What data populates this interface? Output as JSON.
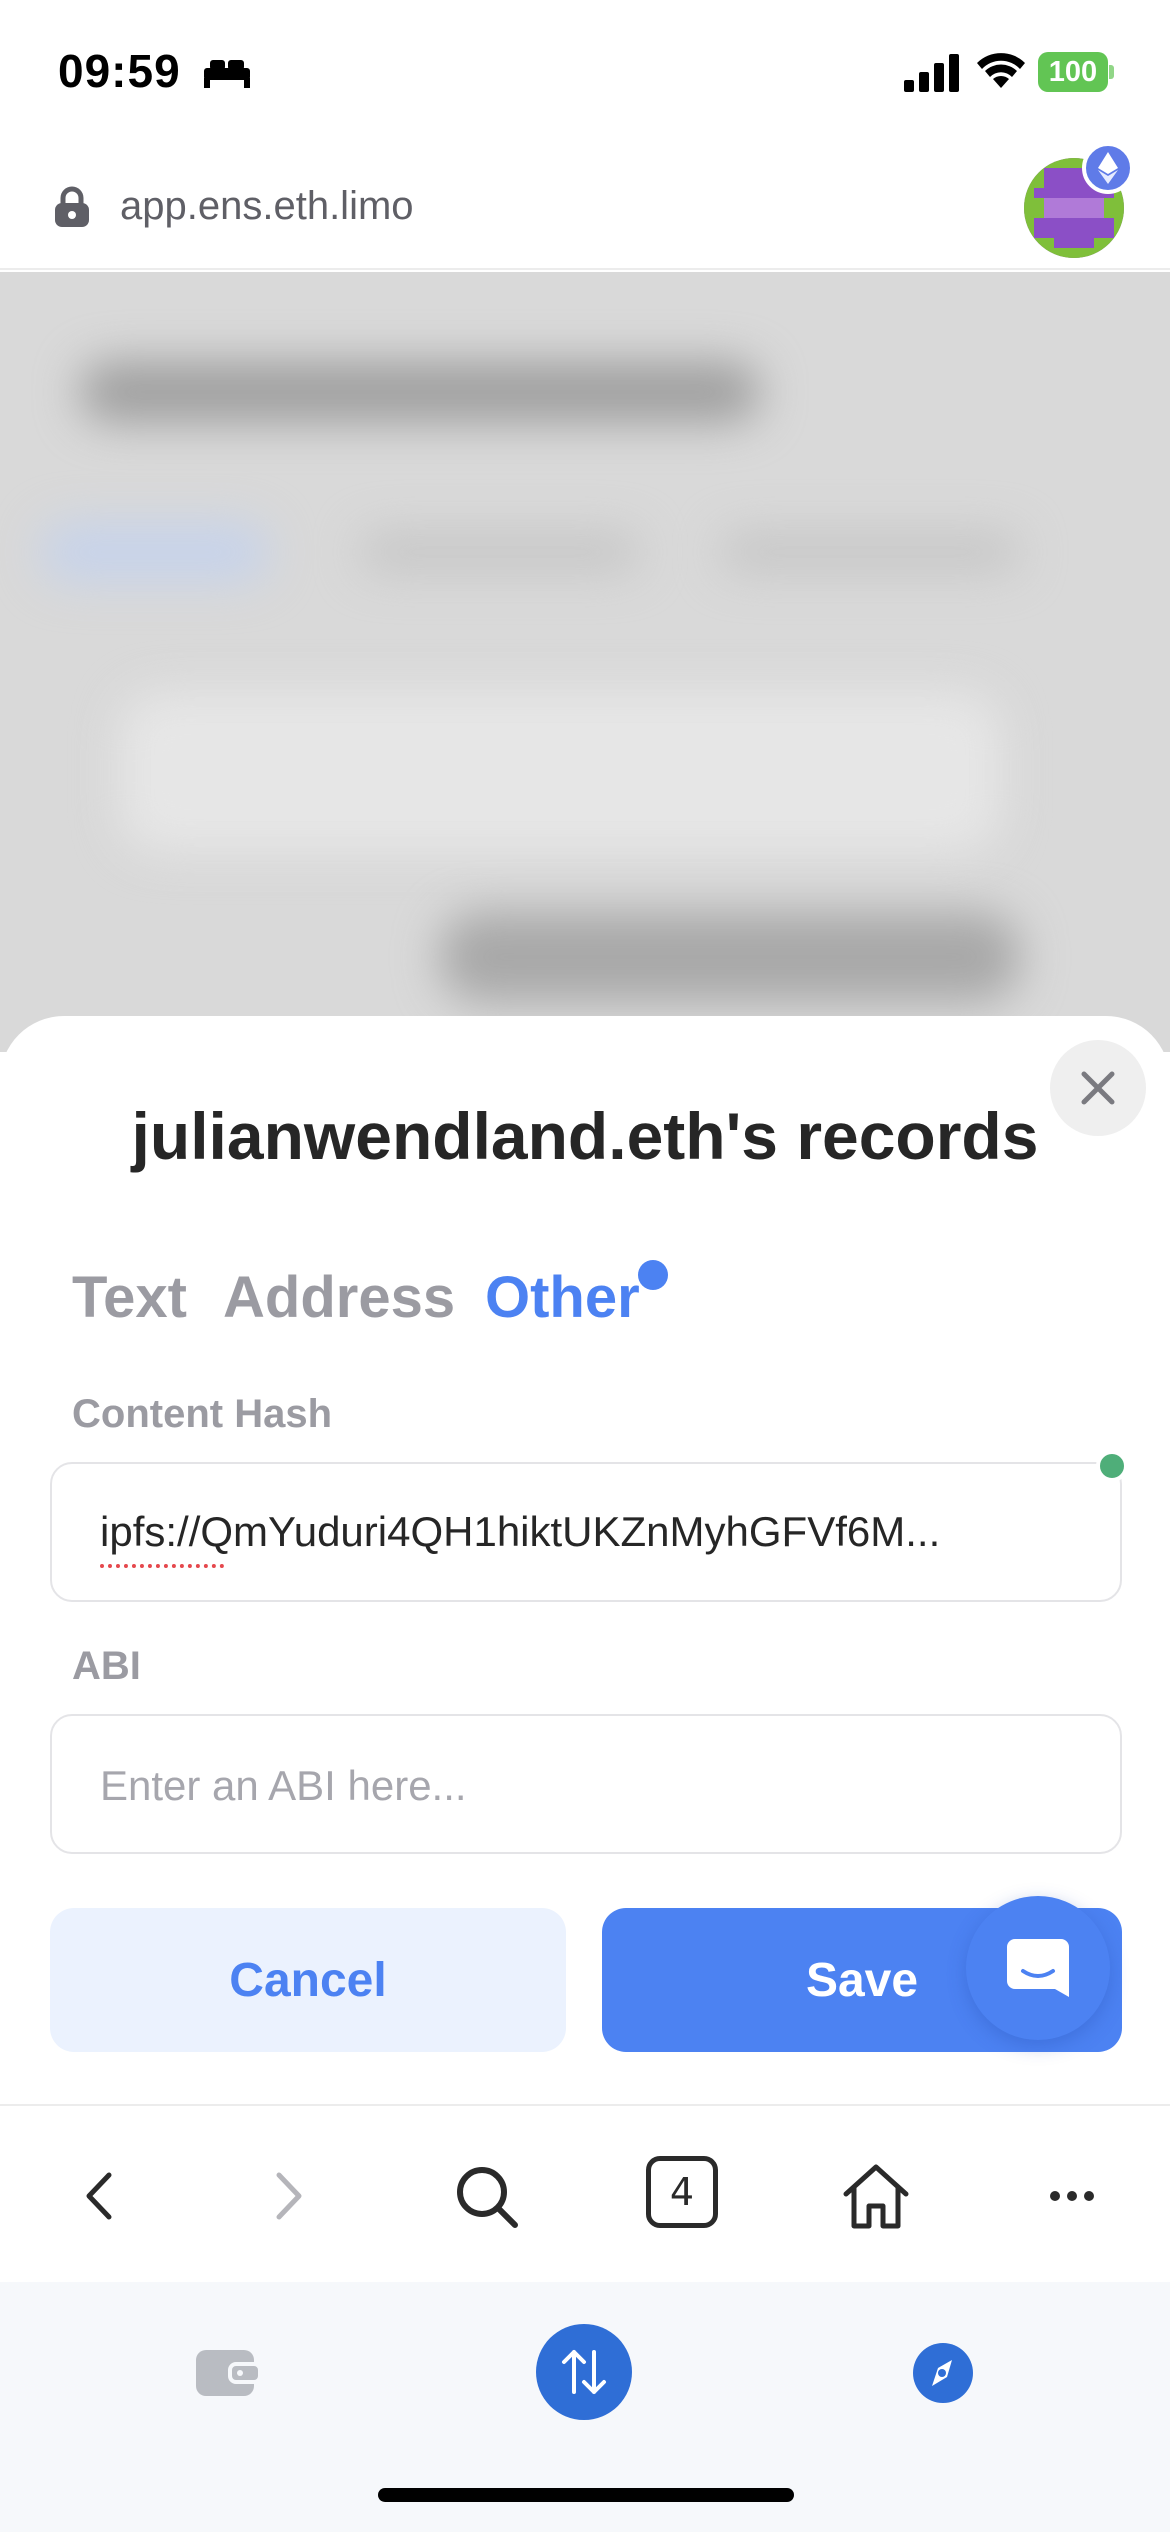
{
  "status_bar": {
    "time": "09:59",
    "battery": "100",
    "battery_color": "#62c554"
  },
  "url_bar": {
    "url": "app.ens.eth.limo"
  },
  "modal": {
    "title": "julianwendland.eth's records",
    "tabs": [
      {
        "label": "Text",
        "active": false
      },
      {
        "label": "Address",
        "active": false
      },
      {
        "label": "Other",
        "active": true
      }
    ],
    "content_hash": {
      "label": "Content Hash",
      "value": "ipfs://QmYuduri4QH1hiktUKZnMyhGFVf6M..."
    },
    "abi": {
      "label": "ABI",
      "placeholder": "Enter an ABI here..."
    },
    "cancel_label": "Cancel",
    "save_label": "Save"
  },
  "toolbar": {
    "tabs_count": "4"
  },
  "colors": {
    "accent": "#4c82f2",
    "accent_light": "#ebf2fe",
    "changed_indicator": "#4fae79"
  },
  "icons": [
    "sleep-icon",
    "signal-icon",
    "wifi-icon",
    "lock-icon",
    "close-icon",
    "chat-icon",
    "back-icon",
    "forward-icon",
    "search-icon",
    "home-icon",
    "more-icon",
    "wallet-icon",
    "swap-icon",
    "explore-icon"
  ]
}
